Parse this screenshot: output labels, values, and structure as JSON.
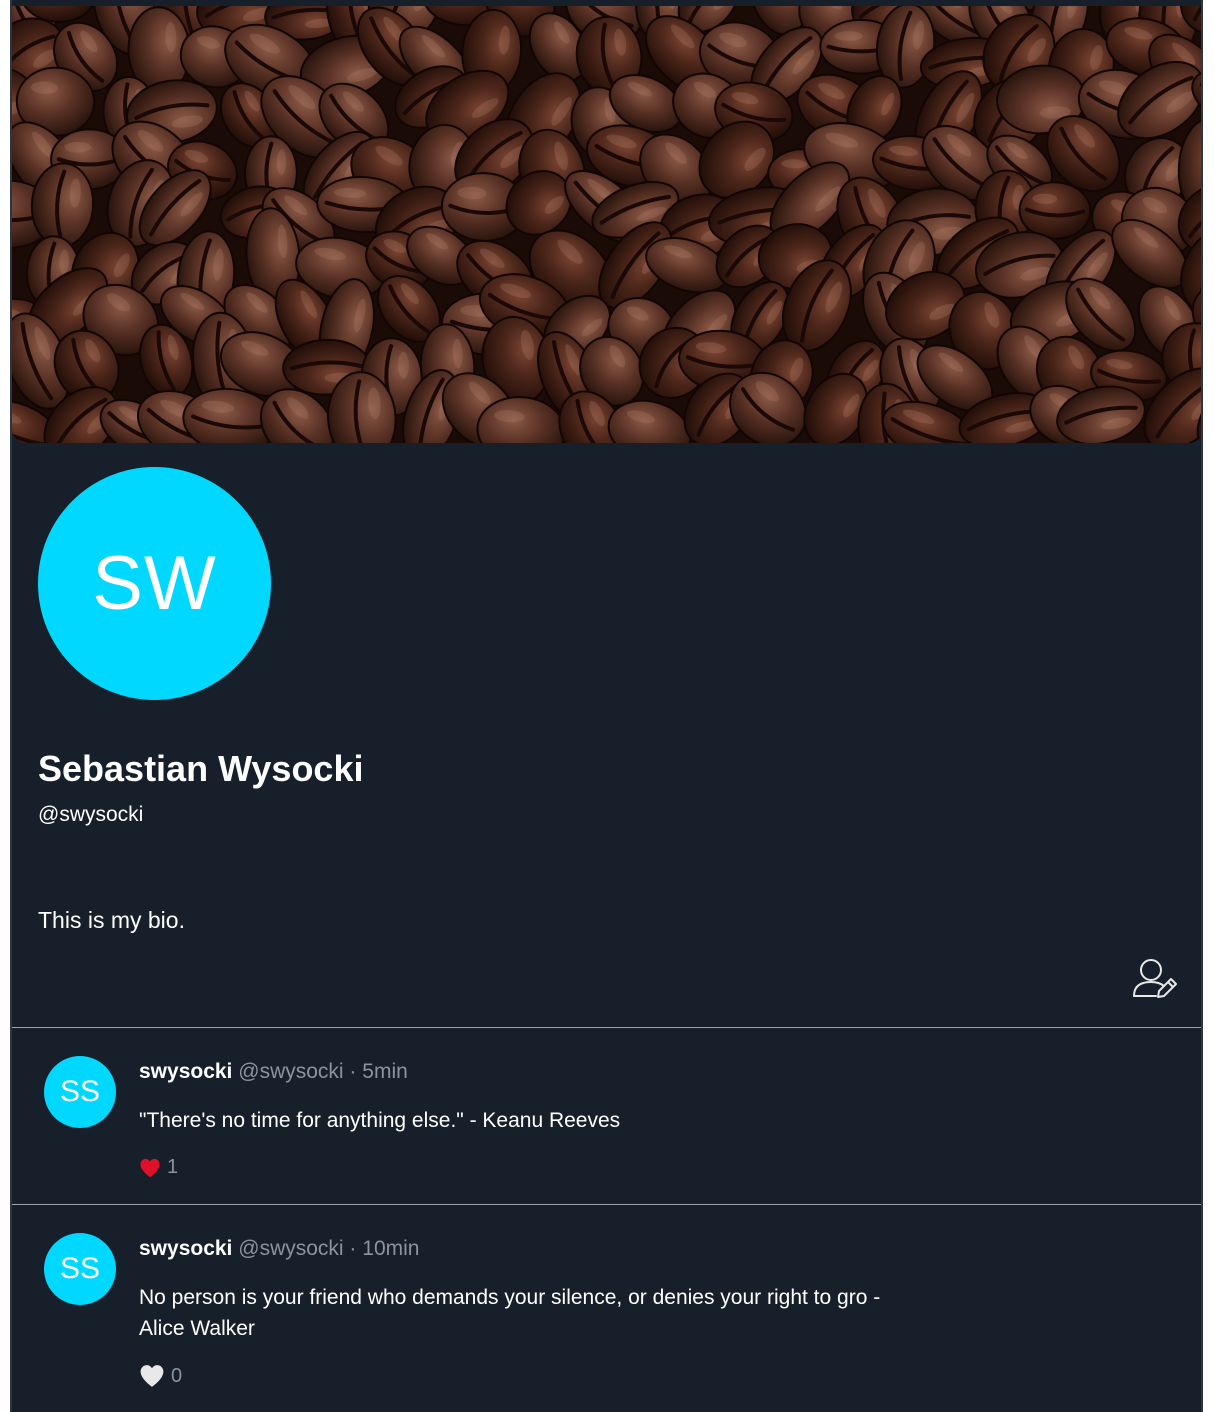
{
  "profile": {
    "avatar_initials": "SW",
    "avatar_color": "#00d8ff",
    "display_name": "Sebastian Wysocki",
    "handle": "@swysocki",
    "bio": "This is my bio.",
    "edit_icon": "edit-profile-icon",
    "banner": "coffee-beans-banner"
  },
  "posts": [
    {
      "avatar_initials": "SS",
      "username": "swysocki",
      "handle": "@swysocki",
      "separator": "·",
      "time": "5min",
      "text": "\"There's no time for anything else.\" - Keanu Reeves",
      "liked": true,
      "like_icon": "heart-filled-icon",
      "like_color": "#e0102a",
      "likes": "1"
    },
    {
      "avatar_initials": "SS",
      "username": "swysocki",
      "handle": "@swysocki",
      "separator": "·",
      "time": "10min",
      "text_line1": "No person is your friend who demands your silence, or denies your right to gro -",
      "text_line2": "Alice Walker",
      "liked": false,
      "like_icon": "heart-outline-icon",
      "like_color": "#e8e8e8",
      "likes": "0"
    }
  ],
  "colors": {
    "background": "#17202a",
    "accent": "#00d8ff",
    "muted_text": "#8a949c",
    "divider": "#9aa3ab"
  }
}
